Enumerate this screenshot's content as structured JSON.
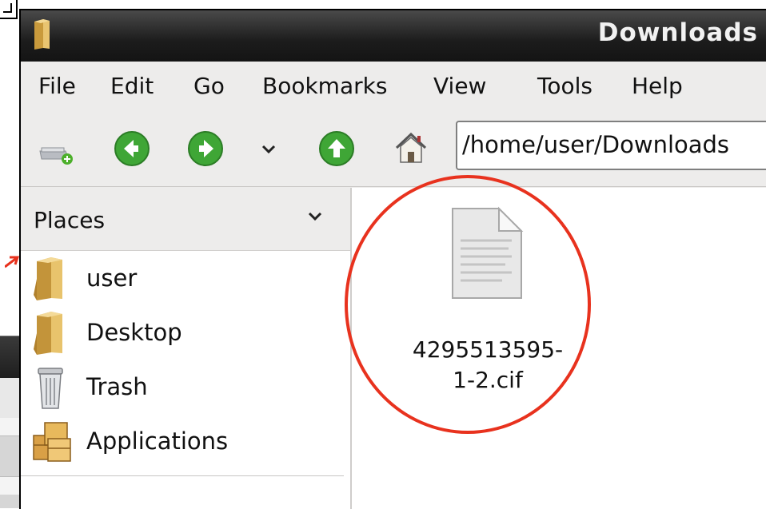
{
  "window": {
    "title": "Downloads"
  },
  "menu": {
    "items": [
      "File",
      "Edit",
      "Go",
      "Bookmarks",
      "View",
      "Tools",
      "Help"
    ]
  },
  "toolbar": {
    "icons": [
      "new-tab-icon",
      "back-icon",
      "forward-icon",
      "history-dropdown-icon",
      "up-icon",
      "home-icon"
    ],
    "path": "/home/user/Downloads"
  },
  "sidebar": {
    "header": "Places",
    "items": [
      {
        "label": "user",
        "icon": "folder-icon"
      },
      {
        "label": "Desktop",
        "icon": "folder-icon"
      },
      {
        "label": "Trash",
        "icon": "trash-icon"
      },
      {
        "label": "Applications",
        "icon": "applications-icon"
      }
    ]
  },
  "content": {
    "files": [
      {
        "name_line1": "4295513595-",
        "name_line2": "1-2.cif",
        "icon": "text-file-icon"
      }
    ]
  },
  "annotation": {
    "color": "#e8321e"
  }
}
